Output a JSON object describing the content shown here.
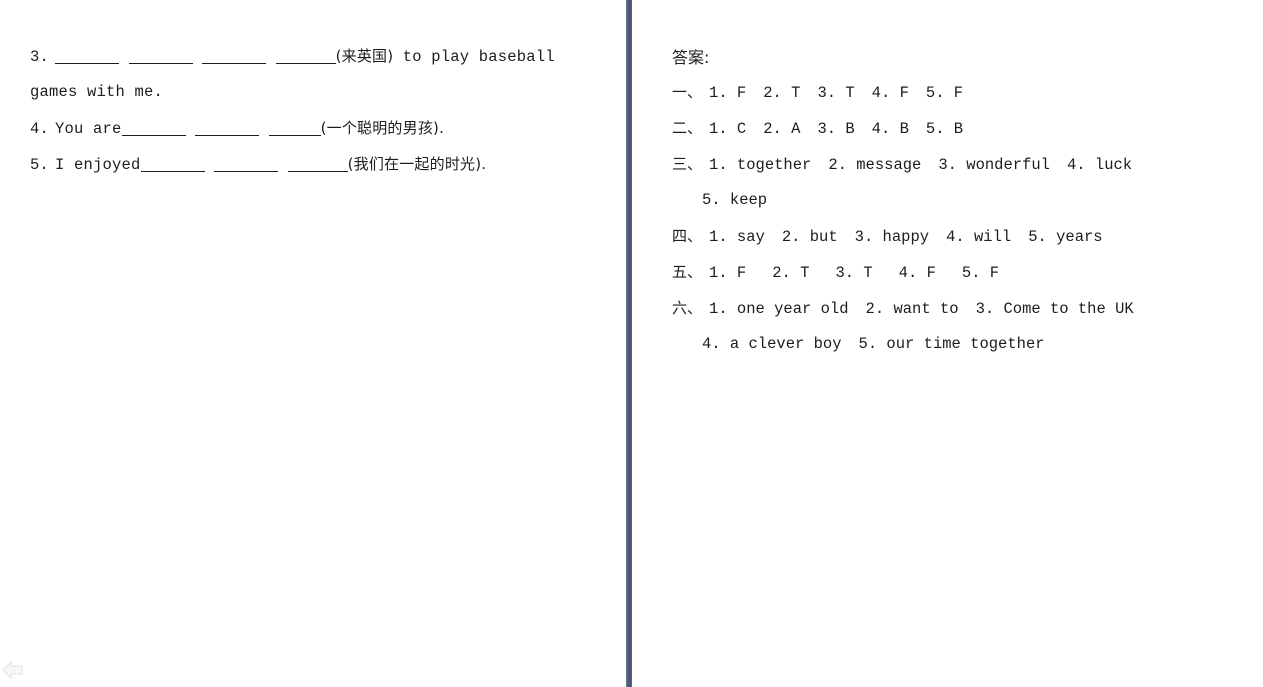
{
  "page": {
    "background_color": "#ffffff",
    "text_color": "#1d1d1d",
    "divider_color": "#4e5d75"
  },
  "left_panel": {
    "questions": [
      {
        "number": "3.",
        "blanks_before": 4,
        "hint": "(来英国)",
        "tail": " to play baseball",
        "continuation": "games with me."
      },
      {
        "number": "4.",
        "stem": "You are",
        "blanks_after": 3,
        "hint": "(一个聪明的男孩).",
        "tail": ""
      },
      {
        "number": "5.",
        "stem": "I enjoyed",
        "blanks_after": 3,
        "hint": "(我们在一起的时光).",
        "tail": ""
      }
    ]
  },
  "right_panel": {
    "heading": "答案:",
    "sections": [
      {
        "label": "一、",
        "items": [
          "1. F",
          "2. T",
          "3. T",
          "4. F",
          "5. F"
        ],
        "spacing": "wide"
      },
      {
        "label": "二、",
        "items": [
          "1. C",
          "2. A",
          "3. B",
          "4. B",
          "5. B"
        ],
        "spacing": "wide"
      },
      {
        "label": "三、",
        "items": [
          "1. together",
          "2. message",
          "3. wonderful",
          "4. luck"
        ],
        "spacing": "wide",
        "continuation": [
          "5. keep"
        ]
      },
      {
        "label": "四、",
        "items": [
          "1. say",
          "2. but",
          "3. happy",
          "4. will",
          "5. years"
        ],
        "spacing": "wide"
      },
      {
        "label": "五、",
        "items": [
          "1. F",
          "2. T",
          "3. T",
          "4. F",
          "5. F"
        ],
        "spacing": "xwide"
      },
      {
        "label": "六、",
        "items": [
          "1. one year old",
          "2. want to",
          "3. Come to the UK"
        ],
        "spacing": "wide",
        "continuation": [
          "4. a clever boy",
          "5. our time together"
        ]
      }
    ]
  },
  "footer": {
    "back_icon": "back-arrow-icon"
  }
}
